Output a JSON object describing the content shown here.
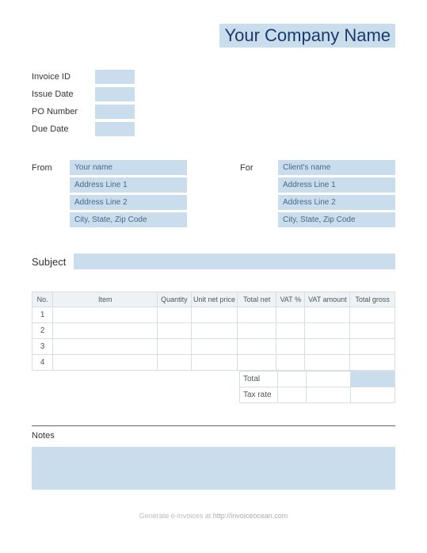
{
  "company_name": "Your Company Name",
  "meta": {
    "invoice_id_label": "Invoice ID",
    "issue_date_label": "Issue Date",
    "po_number_label": "PO Number",
    "due_date_label": "Due Date"
  },
  "from": {
    "label": "From",
    "name": "Your name",
    "addr1": "Address Line 1",
    "addr2": "Address Line 2",
    "csz": "City, State, Zip Code"
  },
  "for": {
    "label": "For",
    "name": "Client's name",
    "addr1": "Address Line 1",
    "addr2": "Address Line 2",
    "csz": "City, State, Zip Code"
  },
  "subject_label": "Subject",
  "columns": {
    "no": "No.",
    "item": "Item",
    "qty": "Quantity",
    "unit": "Unit net price",
    "net": "Total net",
    "vatp": "VAT %",
    "vata": "VAT amount",
    "gross": "Total gross"
  },
  "rows": [
    "1",
    "2",
    "3",
    "4"
  ],
  "totals": {
    "total": "Total",
    "tax": "Tax rate"
  },
  "notes_label": "Notes",
  "footer_prefix": "Generate e-invoices at ",
  "footer_link": "http://invoiceocean.com"
}
